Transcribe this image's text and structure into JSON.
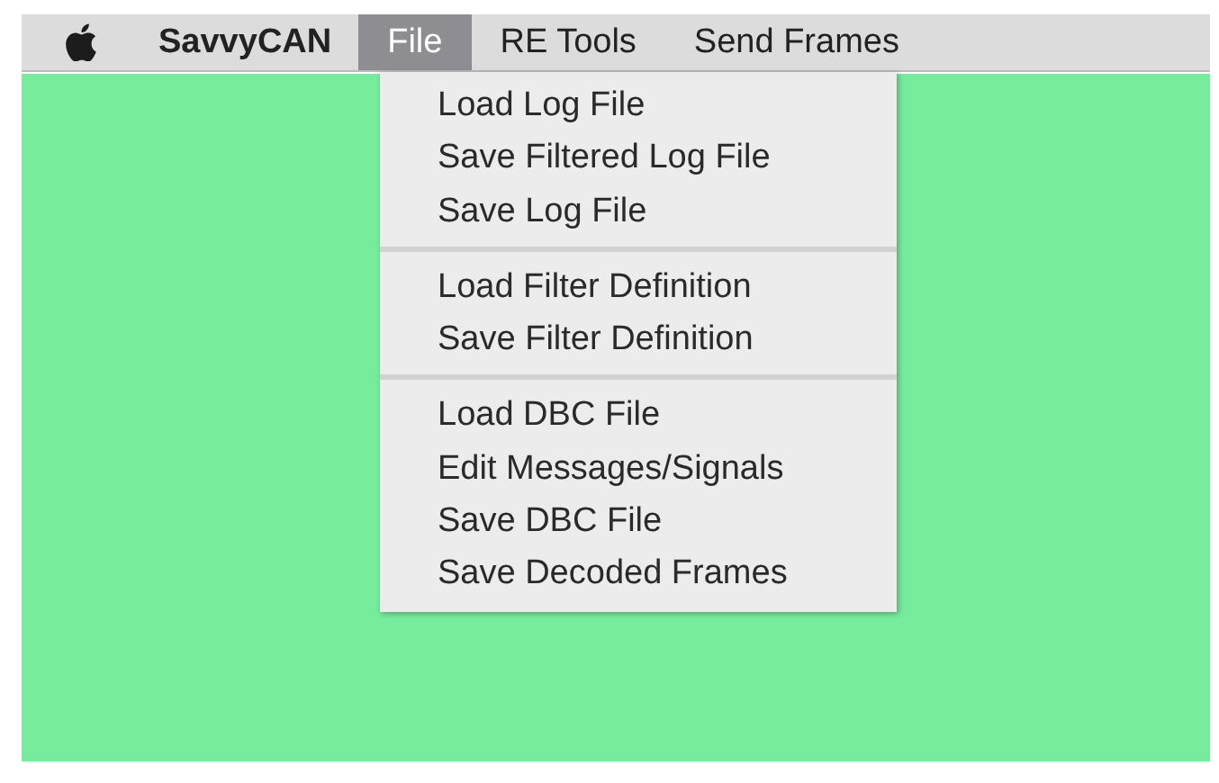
{
  "menu_bar": {
    "items": [
      {
        "label": "SavvyCAN",
        "kind": "app",
        "selected": false
      },
      {
        "label": "File",
        "kind": "menu",
        "selected": true
      },
      {
        "label": "RE Tools",
        "kind": "menu",
        "selected": false
      },
      {
        "label": "Send Frames",
        "kind": "menu",
        "selected": false
      }
    ]
  },
  "dropdown": {
    "groups": [
      [
        "Load Log File",
        "Save Filtered Log File",
        "Save Log File"
      ],
      [
        "Load Filter Definition",
        "Save Filter Definition"
      ],
      [
        "Load DBC File",
        "Edit Messages/Signals",
        "Save DBC File",
        "Save Decoded Frames"
      ]
    ]
  }
}
